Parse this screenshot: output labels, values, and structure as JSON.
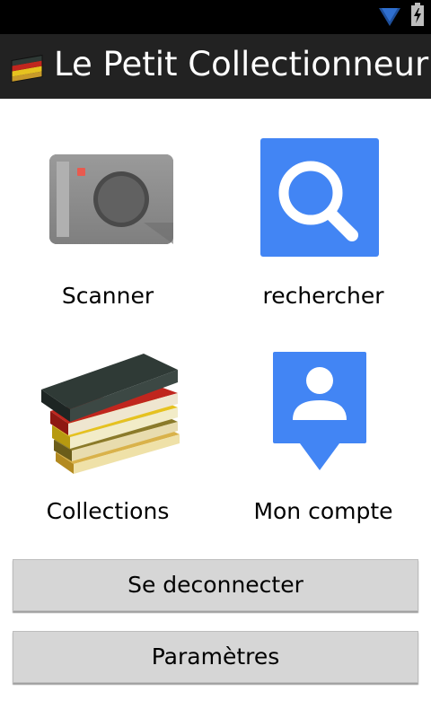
{
  "app": {
    "title": "Le Petit Collectionneur"
  },
  "status_bar": {
    "icons": [
      "wifi-icon",
      "battery-charging-icon"
    ]
  },
  "tiles": [
    {
      "label": "Scanner",
      "icon": "camera-icon"
    },
    {
      "label": "rechercher",
      "icon": "search-icon"
    },
    {
      "label": "Collections",
      "icon": "books-icon"
    },
    {
      "label": "Mon compte",
      "icon": "account-icon"
    }
  ],
  "buttons": {
    "logout_label": "Se deconnecter",
    "settings_label": "Paramètres"
  },
  "colors": {
    "action_bar": "#222222",
    "search_blue": "#4285f4",
    "button_bg": "#d6d6d6"
  }
}
